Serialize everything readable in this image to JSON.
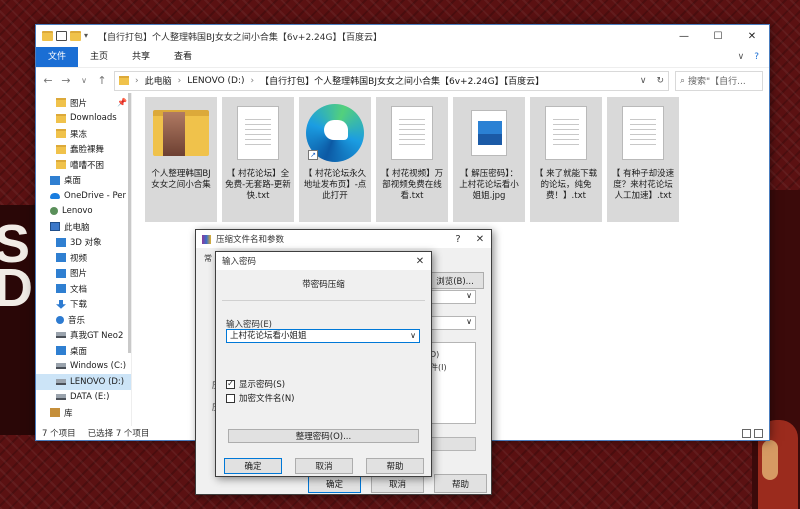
{
  "explorer": {
    "title": "【自行打包】个人整理韩国BJ女女之间小合集【6v+2.24G】【百度云】",
    "controls": {
      "minimize": "—",
      "maximize": "☐",
      "close": "✕"
    },
    "menu": {
      "file": "文件",
      "home": "主页",
      "share": "共享",
      "view": "查看",
      "collapse": "∨",
      "help": "?"
    },
    "nav": {
      "back": "←",
      "forward": "→",
      "down": "∨",
      "up": "↑",
      "refresh": "↻",
      "expand": "∨"
    },
    "address": {
      "pc": "此电脑",
      "drive": "LENOVO (D:)",
      "folder": "【自行打包】个人整理韩国BJ女女之间小合集【6v+2.24G】【百度云】"
    },
    "search_placeholder": "搜索\"【自行...",
    "sidebar": [
      {
        "label": "图片",
        "icon": "folder-icon",
        "pin": "📌"
      },
      {
        "label": "Downloads",
        "icon": "folder-icon"
      },
      {
        "label": "果冻",
        "icon": "folder-icon"
      },
      {
        "label": "蠢脸裸舞",
        "icon": "folder-icon"
      },
      {
        "label": "嘈嘈不困",
        "icon": "folder-icon"
      },
      {
        "label": "桌面",
        "icon": "desktop-icon"
      },
      {
        "label": "OneDrive - Per",
        "icon": "cloud-icon"
      },
      {
        "label": "Lenovo",
        "icon": "user-icon"
      },
      {
        "label": "此电脑",
        "icon": "pc-icon"
      },
      {
        "label": "3D 对象",
        "icon": "3d-objects-icon"
      },
      {
        "label": "视频",
        "icon": "video-icon"
      },
      {
        "label": "图片",
        "icon": "pictures-icon"
      },
      {
        "label": "文档",
        "icon": "documents-icon"
      },
      {
        "label": "下载",
        "icon": "download-icon"
      },
      {
        "label": "音乐",
        "icon": "music-icon"
      },
      {
        "label": "真我GT Neo2",
        "icon": "phone-icon"
      },
      {
        "label": "桌面",
        "icon": "desktop-icon"
      },
      {
        "label": "Windows (C:)",
        "icon": "drive-icon"
      },
      {
        "label": "LENOVO (D:)",
        "icon": "drive-icon",
        "selected": true
      },
      {
        "label": "DATA (E:)",
        "icon": "drive-icon"
      },
      {
        "label": "库",
        "icon": "library-icon"
      }
    ],
    "files": [
      {
        "name": "个人整理韩国BJ女女之间小合集",
        "type": "folder"
      },
      {
        "name": "【 村花论坛】全免费-无套路-更新快.txt",
        "type": "txt"
      },
      {
        "name": "【 村花论坛永久地址发布页】-点此打开",
        "type": "edge-shortcut"
      },
      {
        "name": "【 村花视频】万部视频免费在线看.txt",
        "type": "txt"
      },
      {
        "name": "【 解压密码】：上村花论坛看小姐姐.jpg",
        "type": "jpg"
      },
      {
        "name": "【 来了就能下载的论坛，纯免费！】.txt",
        "type": "txt"
      },
      {
        "name": "【 有种子却没速度？来村花论坛人工加速】.txt",
        "type": "txt"
      }
    ],
    "status": {
      "count": "7 个项目",
      "selected": "已选择 7 个项目"
    }
  },
  "archive_dialog": {
    "title": "压缩文件名和参数",
    "help": "?",
    "close": "✕",
    "tab_partial": "常",
    "browse_label": "浏览(B)...",
    "fragment_labels": [
      "压",
      "默",
      "更",
      "压",
      "压",
      "切",
      "档",
      "档",
      "档",
      "档"
    ],
    "right_fragments": [
      "D)",
      "件(I)"
    ],
    "ok_label": "确定",
    "cancel_label": "取消",
    "help_label": "帮助"
  },
  "password_dialog": {
    "title": "输入密码",
    "close": "✕",
    "heading": "带密码压缩",
    "field_label": "输入密码(E)",
    "password_value": "上村花论坛看小姐姐",
    "show_password_label": "显示密码(S)",
    "show_password_checked": true,
    "encrypt_names_label": "加密文件名(N)",
    "encrypt_names_checked": false,
    "organize_label": "整理密码(O)...",
    "ok_label": "确定",
    "cancel_label": "取消",
    "help_label": "帮助"
  },
  "background": {
    "text_line1": "S",
    "text_line2": "D"
  }
}
